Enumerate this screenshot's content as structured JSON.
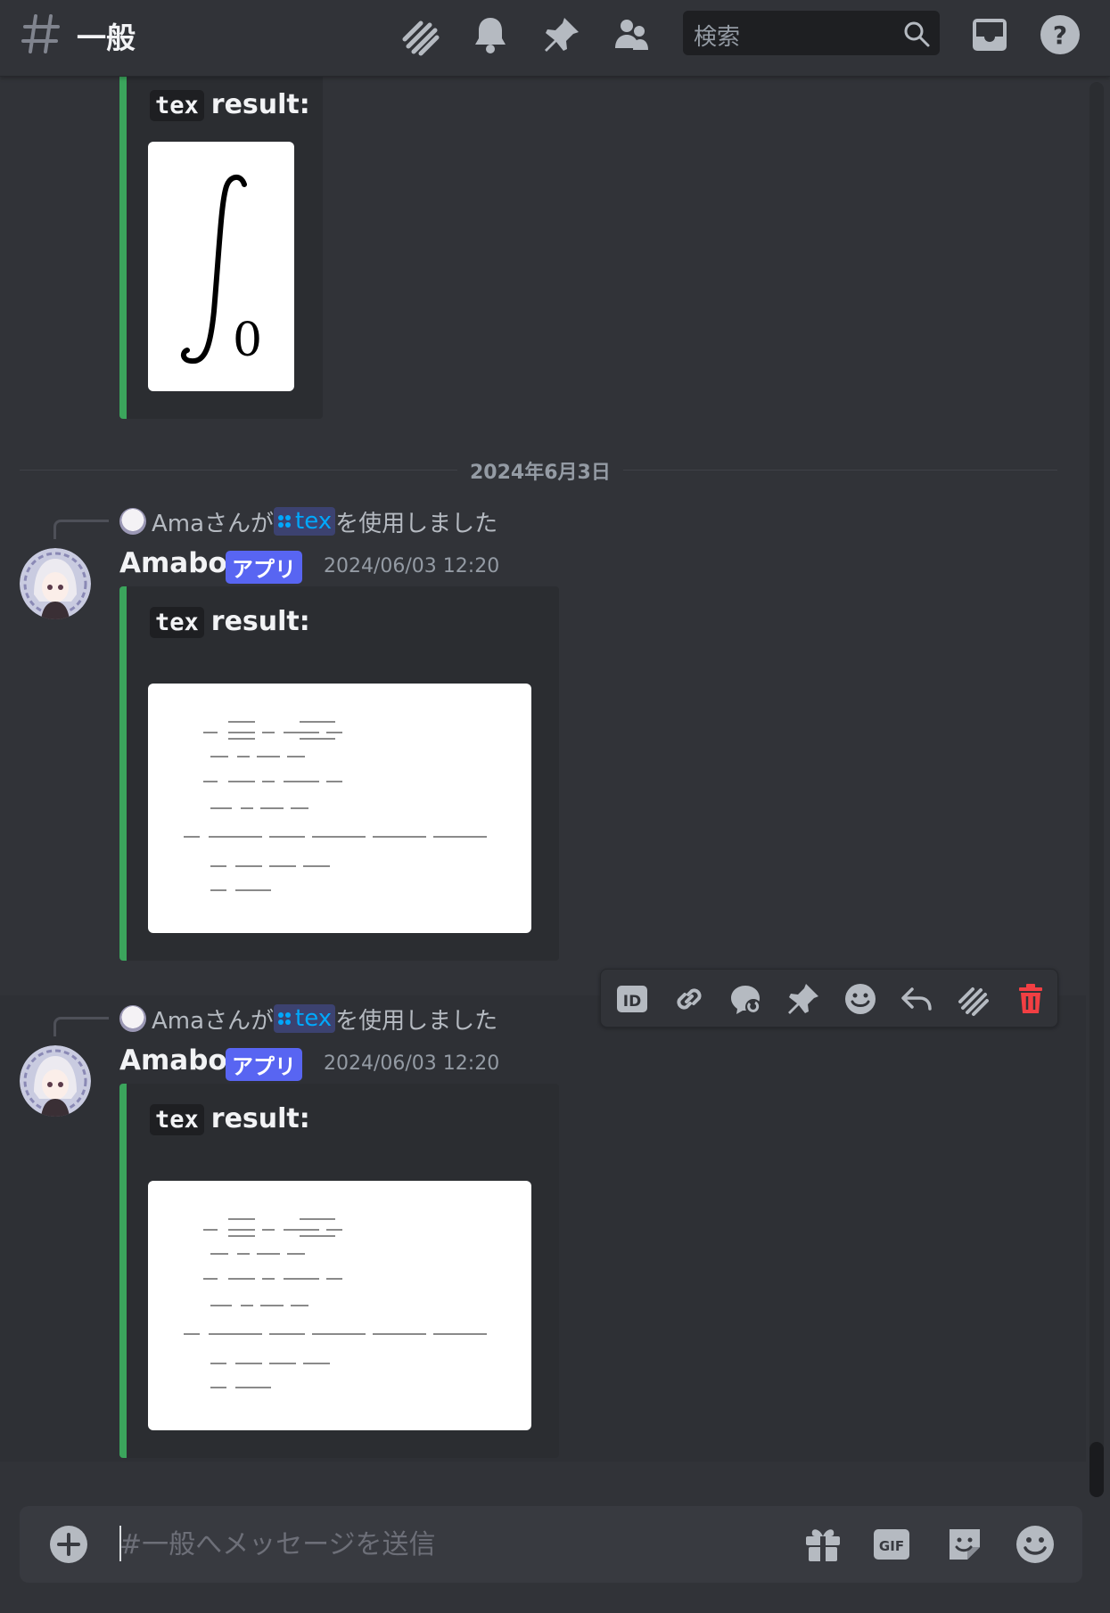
{
  "header": {
    "channel_name": "一般",
    "search_placeholder": "検索"
  },
  "embed_title_code": "tex",
  "embed_title_text": "result:",
  "top_embed": {
    "formula_text": "∫₀"
  },
  "date_divider": "2024年6月3日",
  "messages": [
    {
      "ref_user": "Amaさんが",
      "ref_command": "tex",
      "ref_suffix": "を使用しました",
      "author": "Amabot",
      "badge": "アプリ",
      "timestamp": "2024/06/03 12:20"
    },
    {
      "ref_user": "Amaさんが",
      "ref_command": "tex",
      "ref_suffix": "を使用しました",
      "author": "Amabot",
      "badge": "アプリ",
      "timestamp": "2024/06/03 12:20"
    }
  ],
  "toolbar": [
    "id-icon",
    "link-icon",
    "mention-reply-icon",
    "pin-icon",
    "emoji-icon",
    "reply-icon",
    "thread-icon",
    "trash-icon"
  ],
  "composer": {
    "placeholder": "#一般へメッセージを送信",
    "icons": [
      "gift-icon",
      "gif-icon",
      "sticker-icon",
      "emoji-icon"
    ],
    "gif_label": "GIF"
  },
  "colors": {
    "background": "#313338",
    "embed_border": "#3ba55c",
    "app_badge": "#5865f2",
    "delete": "#f23f43"
  }
}
